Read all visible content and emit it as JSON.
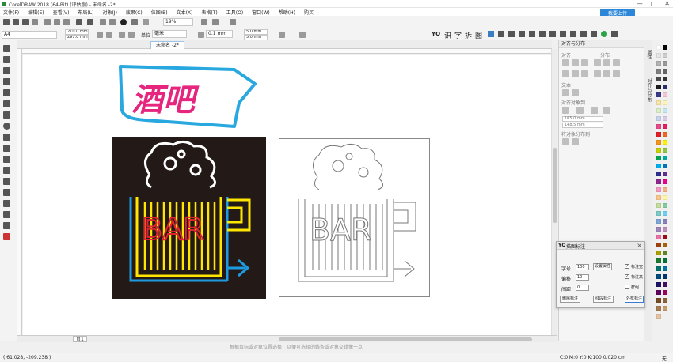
{
  "window": {
    "title": "CorelDRAW 2018 (64-Bit) (评估版) - 未命名 -2*",
    "upload_label": "我要上传",
    "controls": [
      "—",
      "□",
      "✕"
    ]
  },
  "menu": [
    "文件(F)",
    "编辑(E)",
    "查看(V)",
    "布局(L)",
    "对象(J)",
    "效果(C)",
    "位图(B)",
    "文本(X)",
    "表格(T)",
    "工具(O)",
    "窗口(W)",
    "帮助(H)",
    "购买"
  ],
  "toolbar": {
    "zoom": "19%",
    "page_size": "A4",
    "width": "210.0 mm",
    "height": "297.0 mm",
    "units_label": "单位",
    "units": "毫米",
    "nudge": "0.1 mm",
    "dup_x": "5.0 mm",
    "dup_y": "5.0 mm",
    "yq_label": "YQ",
    "plugin_labels": [
      "识",
      "字",
      "拆",
      "图"
    ]
  },
  "document": {
    "tab": "未命名 -2*",
    "page_tab": "页1",
    "hint": "根据鼠标或对象位置选择，以便可选择的线条或对象交错像一点"
  },
  "artwork": {
    "sign_text": "酒吧",
    "bar_text": "BAR",
    "colors": {
      "sign_text": "#e5257e",
      "sign_outline": "#29a8df",
      "bar_text": "#e0242f",
      "mug_yellow": "#ffe600",
      "mug_blue": "#1e9be0",
      "foam": "#ffffff",
      "bg": "#231a17"
    }
  },
  "docker": {
    "title": "对齐与分布",
    "sections": [
      "对齐",
      "分布",
      "文本",
      "对齐对象到",
      "将对象分布到"
    ],
    "x_value": "105.0 mm",
    "y_value": "148.5 mm"
  },
  "side_tabs": [
    "属性",
    "对齐与分布"
  ],
  "dialog": {
    "logo": "YQ",
    "title": "描图标注",
    "font_label": "字号：",
    "font_value": "100",
    "offset_label": "偏移：",
    "offset_value": "10",
    "spacing_label": "间距：",
    "spacing_value": "0",
    "set_attr_button": "设置属性",
    "checks": [
      {
        "label": "标注宽",
        "checked": true
      },
      {
        "label": "标注高",
        "checked": true
      },
      {
        "label": "群组",
        "checked": false
      }
    ],
    "delete_button": "删除标注",
    "mark_button": "线段标注",
    "outer_button": "外框标注"
  },
  "status": {
    "coords": "( 61.028, -209.238 )",
    "fill_info": "C:0 M:0 Y:0 K:100  0.020 cm",
    "fill_none": "无"
  },
  "palette": [
    "#ffffff",
    "#000000",
    "#e6e6e6",
    "#cccccc",
    "#b3b3b3",
    "#999999",
    "#808080",
    "#666666",
    "#4d4d4d",
    "#333333",
    "#1a1a1a",
    "#2b2b6b",
    "#3a3a8c",
    "#f2c7d1",
    "#f9e3a6",
    "#fdf3b2",
    "#d9efc4",
    "#c2e6ef",
    "#c7d5ee",
    "#d8c8e8",
    "#e84a8a",
    "#e61d5c",
    "#e41e26",
    "#f26522",
    "#f7941d",
    "#fff200",
    "#c7d300",
    "#8dc63f",
    "#00a651",
    "#00a99d",
    "#00aeef",
    "#0072bc",
    "#2e3192",
    "#662d91",
    "#92278f",
    "#ec008c",
    "#f49ac1",
    "#f9ad81",
    "#fdc689",
    "#fff799",
    "#c4df9b",
    "#82ca9c",
    "#7accc8",
    "#6dcff6",
    "#7da7d9",
    "#8781bd",
    "#a186be",
    "#bd8cbf",
    "#f06eaa",
    "#9e0b0f",
    "#a0410d",
    "#a36209",
    "#aba000",
    "#598527",
    "#1a7b30",
    "#007236",
    "#00746b",
    "#0076a3",
    "#004a80",
    "#003471",
    "#1b1464",
    "#440e62",
    "#630460",
    "#9e005d",
    "#754c24",
    "#8c6239",
    "#a67c52",
    "#c69c6d",
    "#e5c5a0"
  ]
}
